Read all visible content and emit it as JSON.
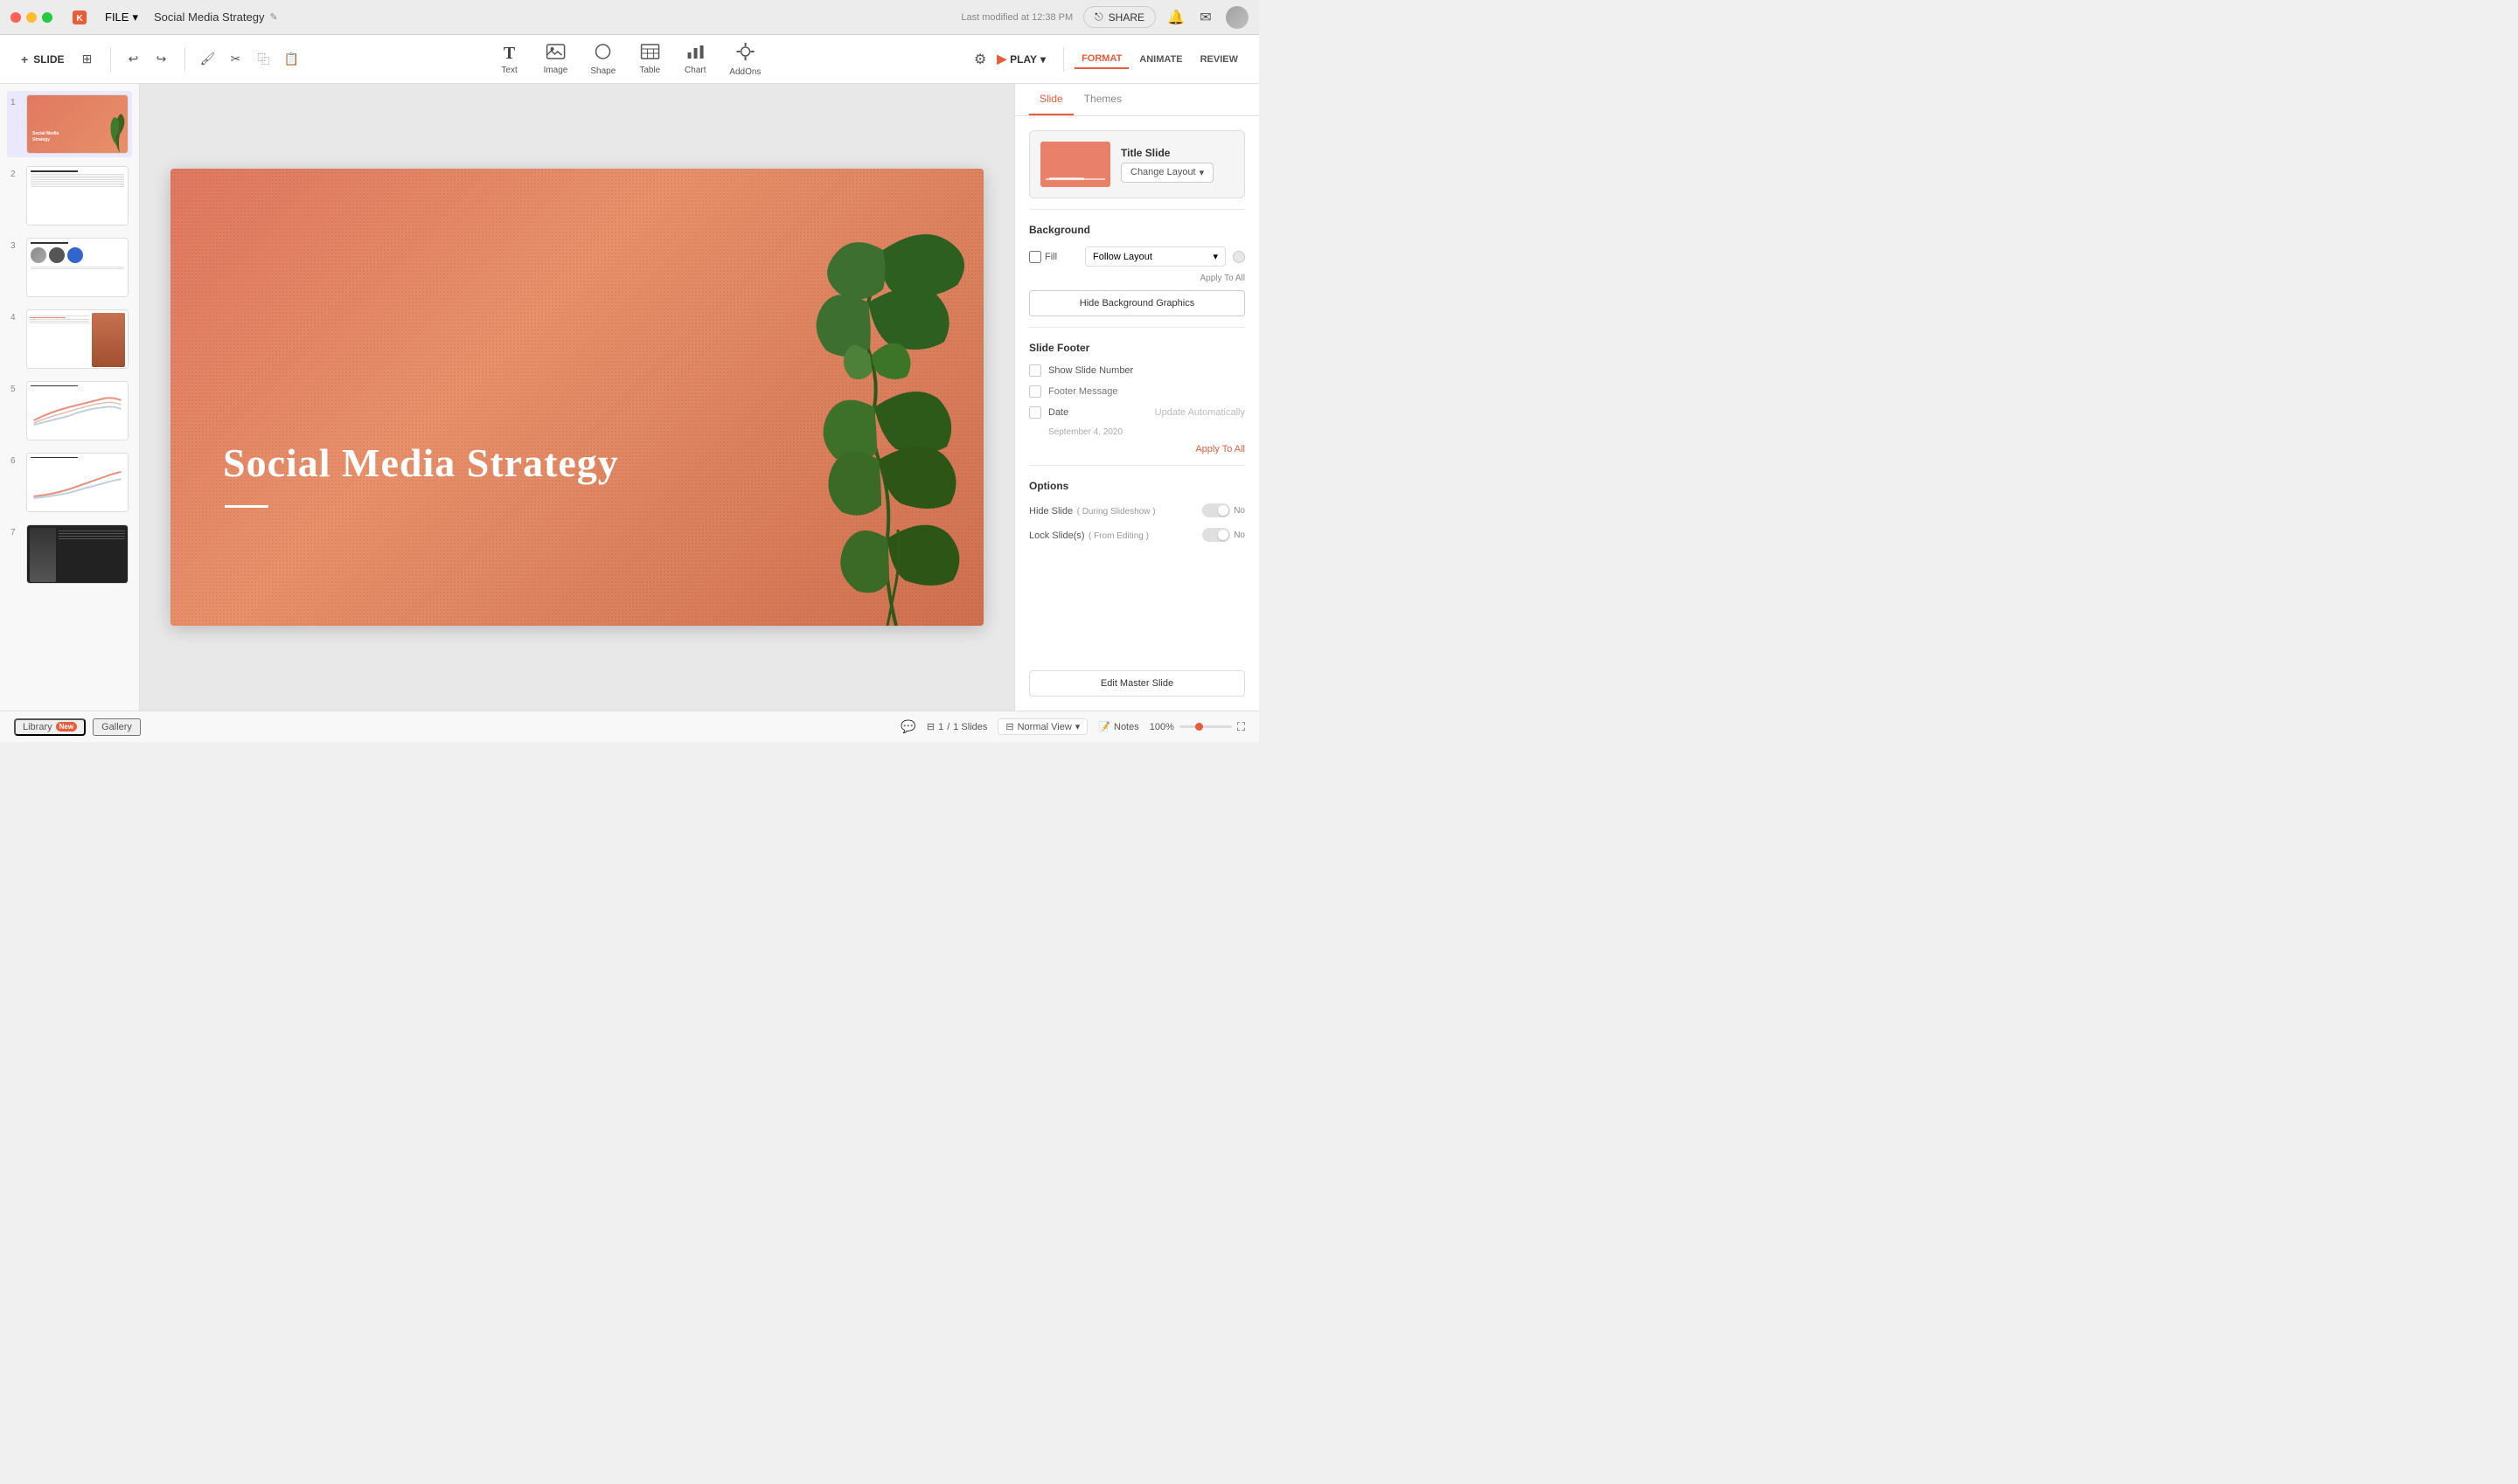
{
  "app": {
    "traffic_lights": [
      "red",
      "yellow",
      "green"
    ],
    "file_label": "FILE",
    "doc_title": "Social Media Strategy",
    "last_modified": "Last modified at 12:38 PM",
    "share_label": "SHARE"
  },
  "toolbar": {
    "slide_label": "SLIDE",
    "tools": [
      {
        "id": "text",
        "icon": "T",
        "label": "Text"
      },
      {
        "id": "image",
        "icon": "🖼",
        "label": "Image"
      },
      {
        "id": "shape",
        "icon": "◯",
        "label": "Shape"
      },
      {
        "id": "table",
        "icon": "⊞",
        "label": "Table"
      },
      {
        "id": "chart",
        "icon": "📊",
        "label": "Chart"
      },
      {
        "id": "addons",
        "icon": "⊕",
        "label": "AddOns"
      }
    ],
    "play_label": "PLAY",
    "format_label": "FORMAT",
    "animate_label": "ANIMATE",
    "review_label": "REVIEW"
  },
  "slide": {
    "title": "Social Media Strategy",
    "current": 1,
    "total": 1
  },
  "panel": {
    "tabs": [
      "Slide",
      "Themes"
    ],
    "active_tab": "Slide",
    "layout": {
      "title": "Title Slide",
      "change_label": "Change Layout"
    },
    "background": {
      "section_title": "Background",
      "fill_label": "Fill",
      "follow_layout_label": "Follow Layout",
      "apply_to_all_label": "Apply To All",
      "hide_bg_label": "Hide Background Graphics"
    },
    "footer": {
      "section_title": "Slide Footer",
      "show_slide_num_label": "Show Slide Number",
      "footer_message_label": "Footer Message",
      "footer_placeholder": "Footer Message",
      "date_label": "Date",
      "update_auto_label": "Update Automatically",
      "date_value": "September 4, 2020",
      "apply_to_all_label": "Apply To All"
    },
    "options": {
      "section_title": "Options",
      "hide_slide_label": "Hide Slide",
      "hide_slide_sub": "( During Slideshow )",
      "hide_slide_value": "No",
      "lock_slide_label": "Lock Slide(s)",
      "lock_slide_sub": "( From Editing )",
      "lock_slide_value": "No"
    },
    "edit_master_label": "Edit Master Slide"
  },
  "bottom": {
    "library_label": "Library",
    "library_badge": "New",
    "gallery_label": "Gallery",
    "view_label": "Normal View",
    "notes_label": "Notes",
    "zoom_pct": "100%",
    "page_current": "1",
    "page_total": "1 Slides"
  },
  "slides": [
    {
      "num": 1,
      "type": "title"
    },
    {
      "num": 2,
      "type": "overview"
    },
    {
      "num": 3,
      "type": "team"
    },
    {
      "num": 4,
      "type": "content"
    },
    {
      "num": 5,
      "type": "chart"
    },
    {
      "num": 6,
      "type": "chart2"
    },
    {
      "num": 7,
      "type": "dark"
    }
  ]
}
